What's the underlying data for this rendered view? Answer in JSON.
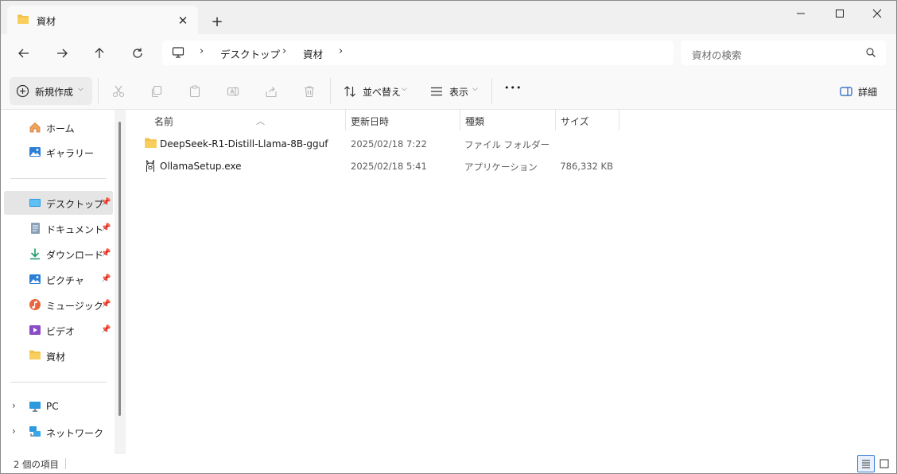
{
  "window": {
    "tab_title": "資材",
    "new_tab_symbol": "+",
    "tab_close_symbol": "✕"
  },
  "address_bar": {
    "breadcrumbs": [
      "デスクトップ",
      "資材"
    ],
    "search_placeholder": "資材の検索"
  },
  "toolbar": {
    "new_label": "新規作成",
    "sort_label": "並べ替え",
    "view_label": "表示",
    "more_symbol": "•••",
    "details_label": "詳細"
  },
  "sidebar": {
    "quick": [
      {
        "label": "ホーム",
        "icon": "home-icon"
      },
      {
        "label": "ギャラリー",
        "icon": "gallery-icon"
      }
    ],
    "pinned": [
      {
        "label": "デスクトップ",
        "icon": "desktop-icon",
        "pinned": true,
        "selected": true
      },
      {
        "label": "ドキュメント",
        "icon": "documents-icon",
        "pinned": true
      },
      {
        "label": "ダウンロード",
        "icon": "download-icon",
        "pinned": true
      },
      {
        "label": "ピクチャ",
        "icon": "pictures-icon",
        "pinned": true
      },
      {
        "label": "ミュージック",
        "icon": "music-icon",
        "pinned": true
      },
      {
        "label": "ビデオ",
        "icon": "video-icon",
        "pinned": true
      },
      {
        "label": "資材",
        "icon": "folder-icon",
        "pinned": false
      }
    ],
    "locations": [
      {
        "label": "PC",
        "icon": "pc-icon"
      },
      {
        "label": "ネットワーク",
        "icon": "network-icon"
      }
    ]
  },
  "columns": {
    "name": "名前",
    "date": "更新日時",
    "type": "種類",
    "size": "サイズ"
  },
  "files": [
    {
      "name": "DeepSeek-R1-Distill-Llama-8B-gguf",
      "date": "2025/02/18 7:22",
      "type": "ファイル フォルダー",
      "size": "",
      "icon": "folder-icon"
    },
    {
      "name": "OllamaSetup.exe",
      "date": "2025/02/18 5:41",
      "type": "アプリケーション",
      "size": "786,332 KB",
      "icon": "ollama-app-icon"
    }
  ],
  "status": {
    "item_count": "2 個の項目"
  },
  "colors": {
    "folder": "#f3c14a",
    "accent": "#3a7bd5"
  }
}
